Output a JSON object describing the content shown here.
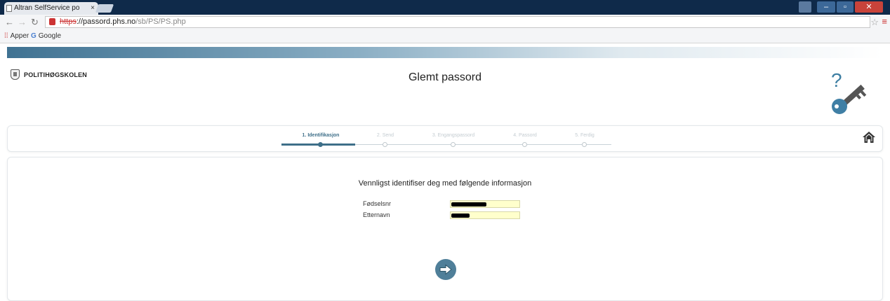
{
  "browser": {
    "tab_title": "Altran SelfService po",
    "tab_close": "×",
    "url_scheme": "https",
    "url_host": "://passord.phs.no",
    "url_path": "/sb/PS/PS.php",
    "bookmarks": [
      {
        "label": "Apper",
        "icon": "apps-grid-icon"
      },
      {
        "label": "Google",
        "icon": "google-icon"
      }
    ],
    "colors": {
      "titlebar": "#0f2a4a",
      "close": "#c8433a"
    }
  },
  "header": {
    "logo_text": "POLITIHØGSKOLEN",
    "title": "Glemt passord",
    "decoration_icon": "question-key-icon"
  },
  "steps": {
    "items": [
      {
        "label": "1. Identifikasjon",
        "active": true
      },
      {
        "label": "2. Send",
        "active": false
      },
      {
        "label": "3. Engangspassord",
        "active": false
      },
      {
        "label": "4. Passord",
        "active": false
      },
      {
        "label": "5. Ferdig",
        "active": false
      }
    ],
    "home_icon": "home-icon",
    "accent": "#3e6f89"
  },
  "form": {
    "instruction": "Vennligst identifiser deg med følgende informasjon",
    "fields": [
      {
        "label": "Fødselsnr",
        "value": ""
      },
      {
        "label": "Etternavn",
        "value": ""
      }
    ],
    "submit_icon": "arrow-right-circle-icon"
  }
}
